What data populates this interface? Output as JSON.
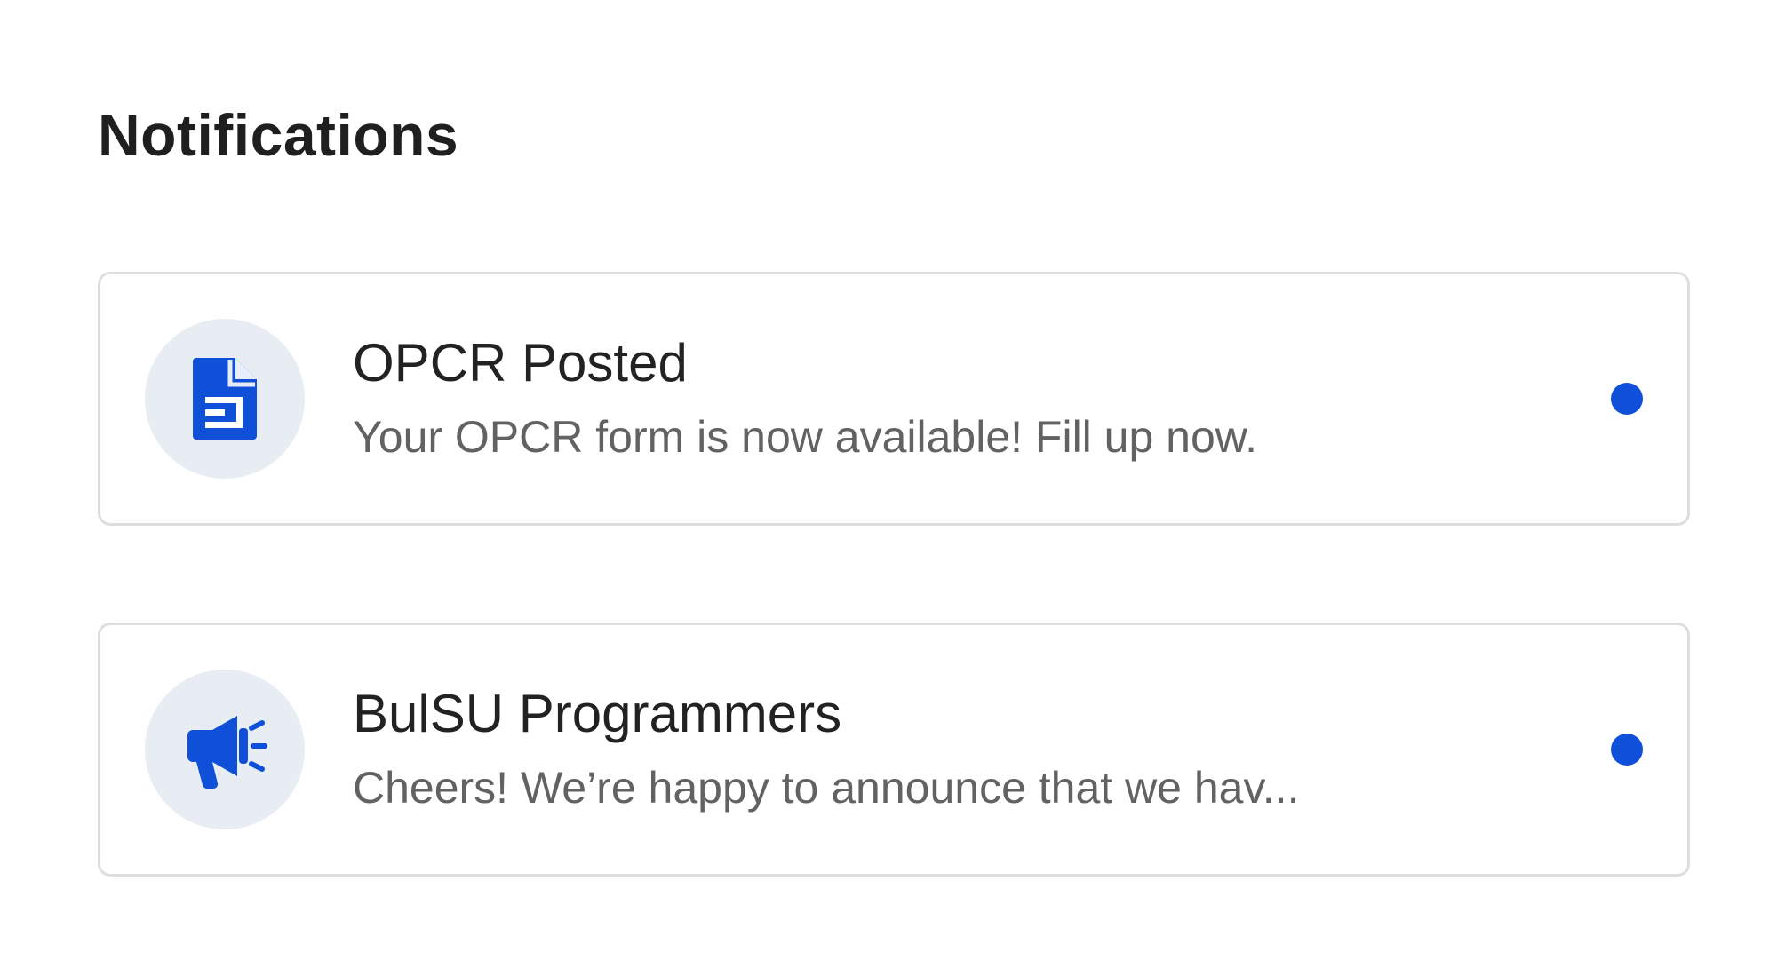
{
  "page": {
    "title": "Notifications"
  },
  "colors": {
    "accent": "#1050d8",
    "icon_bg": "#e8edf3",
    "card_border": "#dedede",
    "title_text": "#222222",
    "message_text": "#626262"
  },
  "notifications": [
    {
      "icon": "document-icon",
      "title": "OPCR Posted",
      "message": "Your OPCR form is now available! Fill up now.",
      "unread": true
    },
    {
      "icon": "megaphone-icon",
      "title": "BulSU Programmers",
      "message": "Cheers! We’re happy to announce that we hav...",
      "unread": true
    }
  ]
}
